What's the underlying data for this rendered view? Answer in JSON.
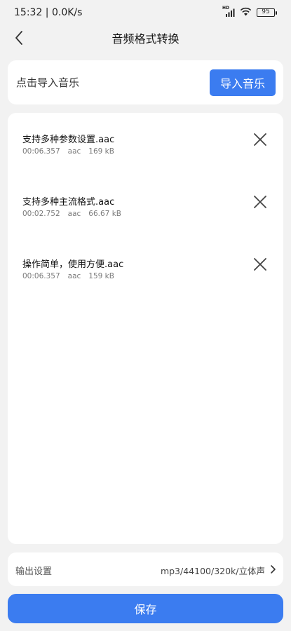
{
  "status_bar": {
    "time_speed": "15:32 | 0.0K/s",
    "network_badge": "HD",
    "battery": "95"
  },
  "header": {
    "title": "音频格式转换",
    "back_icon": "chevron-left-icon"
  },
  "import": {
    "hint": "点击导入音乐",
    "button_label": "导入音乐"
  },
  "files": [
    {
      "name": "支持多种参数设置.aac",
      "duration": "00:06.357",
      "format": "aac",
      "size": "169 kB"
    },
    {
      "name": "支持多种主流格式.aac",
      "duration": "00:02.752",
      "format": "aac",
      "size": "66.67 kB"
    },
    {
      "name": "操作简单，使用方便.aac",
      "duration": "00:06.357",
      "format": "aac",
      "size": "159 kB"
    }
  ],
  "output": {
    "label": "输出设置",
    "value": "mp3/44100/320k/立体声"
  },
  "save_label": "保存",
  "colors": {
    "accent": "#3b7cf0",
    "background": "#f2f2f2",
    "card": "#ffffff"
  }
}
